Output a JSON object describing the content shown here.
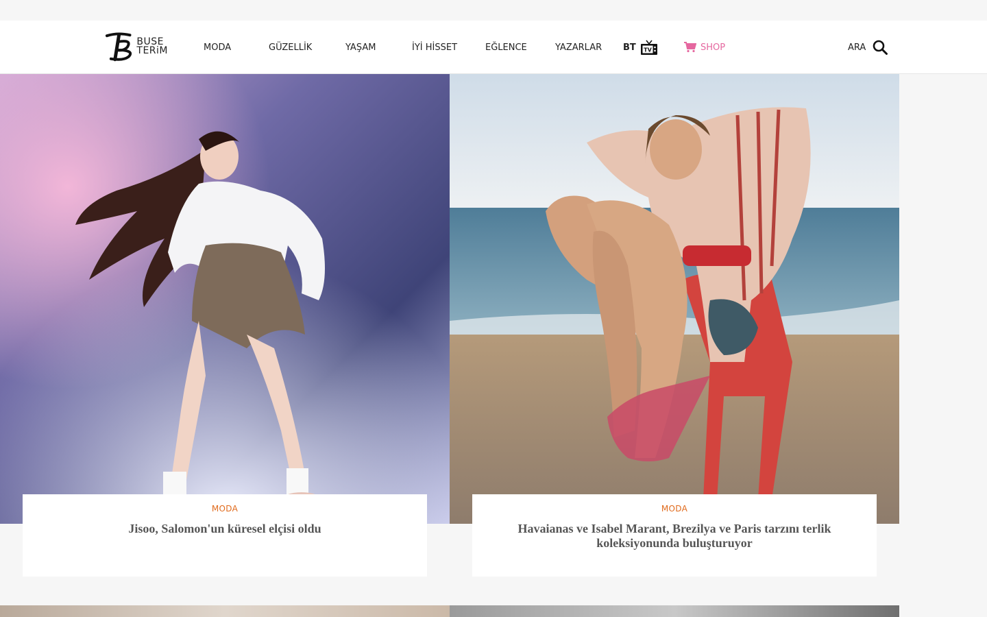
{
  "logo": {
    "line1": "BUSE",
    "line2": "TERiM"
  },
  "nav": [
    {
      "label": "MODA"
    },
    {
      "label": "GÜZELLİK"
    },
    {
      "label": "YAŞAM"
    },
    {
      "label": "İYİ HİSSET"
    },
    {
      "label": "EĞLENCE"
    },
    {
      "label": "YAZARLAR"
    }
  ],
  "bt_tv": {
    "label": "BT",
    "tv_label": "TV"
  },
  "shop": {
    "label": "SHOP"
  },
  "search": {
    "label": "ARA"
  },
  "colors": {
    "accent_pink": "#e5679f",
    "category_orange": "#e06a1c"
  },
  "articles": [
    {
      "category": "MODA",
      "title": "Jisoo, Salomon'un küresel elçisi oldu"
    },
    {
      "category": "MODA",
      "title": "Havaianas ve Isabel Marant, Brezilya ve Paris tarzını terlik koleksiyonunda buluşturuyor"
    }
  ]
}
